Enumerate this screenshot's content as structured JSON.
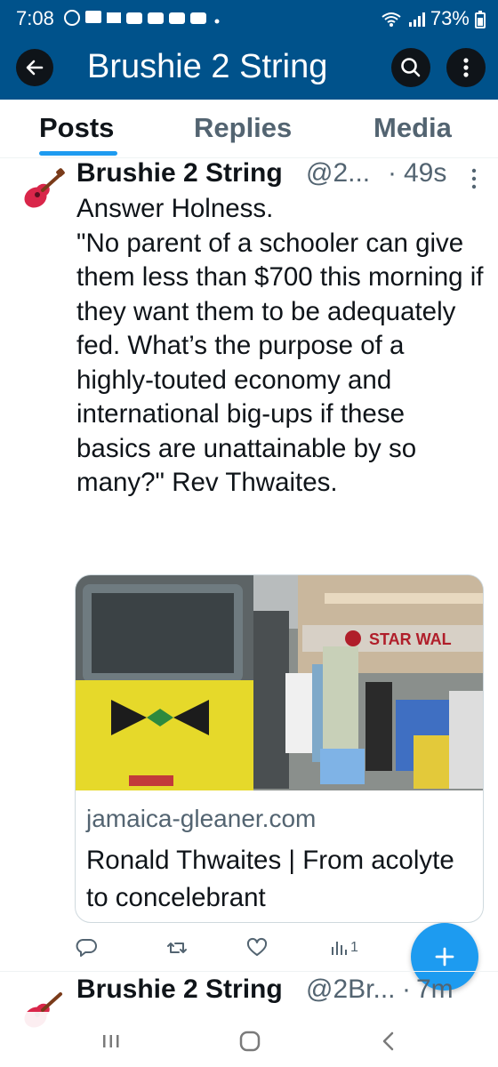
{
  "status_bar": {
    "time": "7:08",
    "notification_icons": [
      "whatsapp-icon",
      "chat-icon",
      "bird-icon",
      "youtube-icon",
      "youtube-icon",
      "youtube-icon",
      "youtube-icon",
      "youtube-icon",
      "dot-icon"
    ],
    "battery": "73%"
  },
  "header": {
    "title": "Brushie 2 String",
    "accent_color": "#00528b"
  },
  "tabs": [
    {
      "label": "Posts",
      "active": true
    },
    {
      "label": "Replies",
      "active": false
    },
    {
      "label": "Media",
      "active": false
    }
  ],
  "tweet": {
    "name": "Brushie 2 String",
    "handle": "@2...",
    "separator": "·",
    "time": "49s",
    "lines": [
      "Answer Holness.",
      "\"No parent of a schooler can give them less than $700 this morning if they want them to be adequately fed. What’s the purpose of a highly-touted economy and international big-ups if these basics are unattainable by so many?\" Rev Thwaites."
    ],
    "card": {
      "domain": "jamaica-gleaner.com",
      "title": "Ronald Thwaites | From acolyte to concelebrant",
      "image_sign_text": "STAR WAL"
    },
    "actions": {
      "views": "1"
    }
  },
  "next_tweet": {
    "name": "Brushie 2 String",
    "handle": "@2Br...",
    "separator": "·",
    "time": "7m"
  },
  "brand_color": "#1d9bf0"
}
